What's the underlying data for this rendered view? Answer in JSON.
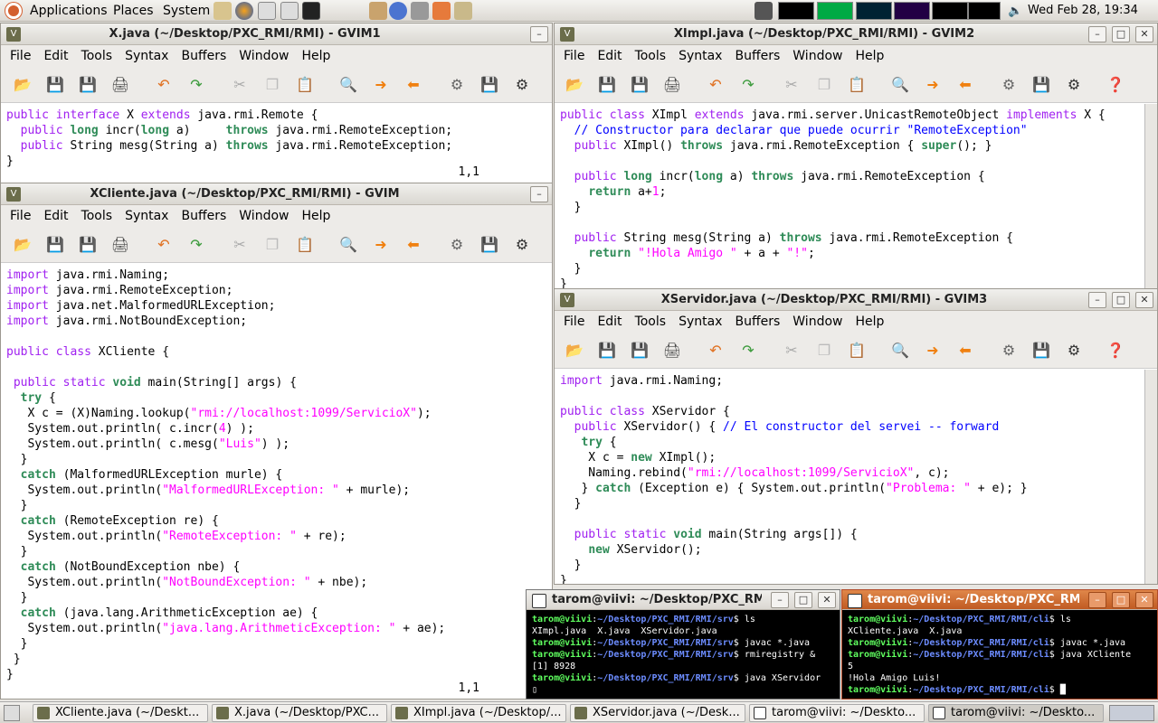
{
  "panel": {
    "applications": "Applications",
    "places": "Places",
    "system": "System",
    "clock": "Wed Feb 28, 19:34"
  },
  "menu": {
    "file": "File",
    "edit": "Edit",
    "tools": "Tools",
    "syntax": "Syntax",
    "buffers": "Buffers",
    "window": "Window",
    "help": "Help"
  },
  "win_x": {
    "title": "X.java (~/Desktop/PXC_RMI/RMI) - GVIM1",
    "ruler": "1,1"
  },
  "win_cliente": {
    "title": "XCliente.java (~/Desktop/PXC_RMI/RMI) - GVIM",
    "ruler": "1,1"
  },
  "win_impl": {
    "title": "XImpl.java (~/Desktop/PXC_RMI/RMI) - GVIM2"
  },
  "win_servidor": {
    "title": "XServidor.java (~/Desktop/PXC_RMI/RMI) - GVIM3"
  },
  "term1": {
    "title": "tarom@viivi: ~/Desktop/PXC_RMI"
  },
  "term2": {
    "title": "tarom@viivi: ~/Desktop/PXC_RMI"
  },
  "taskbar": {
    "t1": "XCliente.java (~/Deskt...",
    "t2": "X.java (~/Desktop/PXC...",
    "t3": "XImpl.java (~/Desktop/...",
    "t4": "XServidor.java (~/Desk...",
    "t5": "tarom@viivi: ~/Deskto...",
    "t6": "tarom@viivi: ~/Deskto..."
  }
}
